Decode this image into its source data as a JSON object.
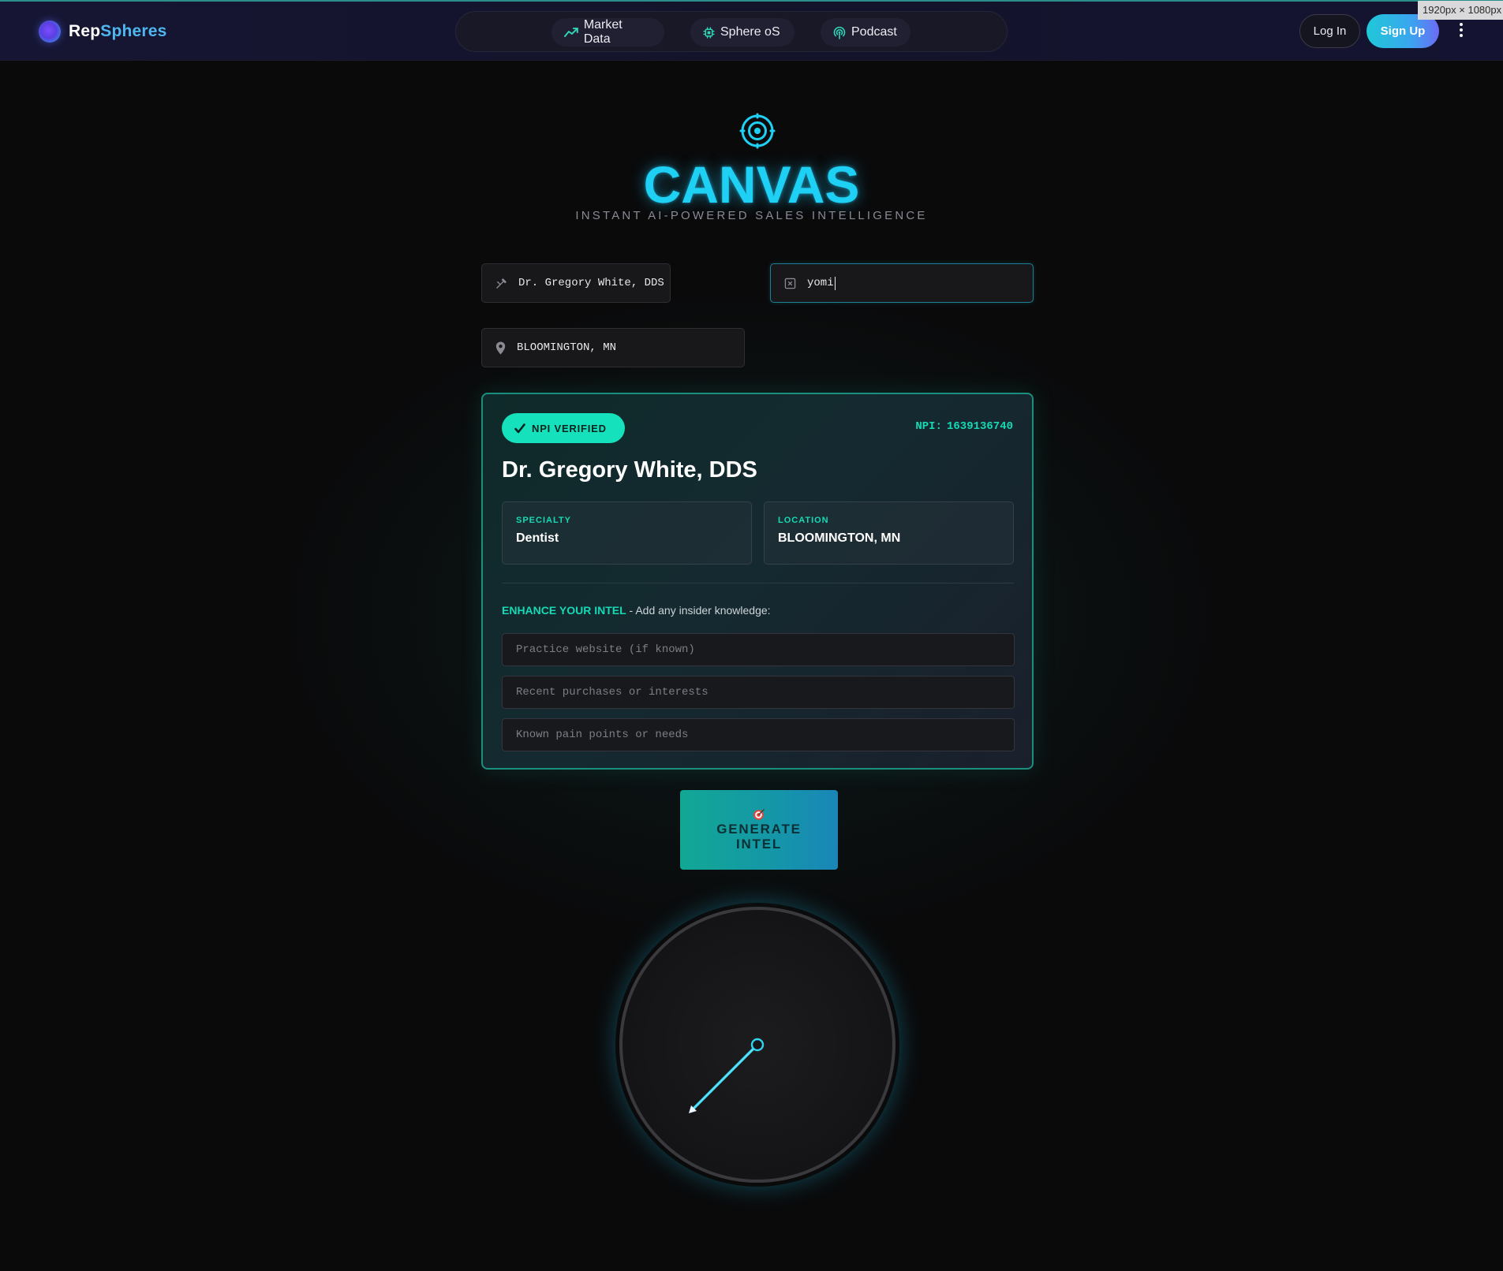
{
  "header": {
    "logo_part1": "Rep",
    "logo_part2": "Spheres",
    "nav": [
      {
        "label": "Market Data",
        "icon": "trend-chart-icon"
      },
      {
        "label": "Sphere oS",
        "icon": "chip-icon"
      },
      {
        "label": "Podcast",
        "icon": "broadcast-icon"
      }
    ],
    "login_label": "Log In",
    "signup_label": "Sign Up",
    "viewport_badge": "1920px × 1080px"
  },
  "hero": {
    "icon": "target-icon",
    "title": "CANVAS",
    "subtitle": "INSTANT AI-POWERED SALES INTELLIGENCE"
  },
  "search": {
    "doctor_value": "Dr. Gregory White, DDS",
    "query_value": "yomi",
    "location_value": "BLOOMINGTON, MN"
  },
  "result_card": {
    "badge": "NPI VERIFIED",
    "npi_label": "NPI:",
    "npi_value": "1639136740",
    "name": "Dr. Gregory White, DDS",
    "specialty_label": "SPECIALTY",
    "specialty_value": "Dentist",
    "location_label": "LOCATION",
    "location_value": "BLOOMINGTON, MN",
    "enhance_highlight": "ENHANCE YOUR INTEL",
    "enhance_text": " - Add any insider knowledge:",
    "inputs": [
      {
        "placeholder": "Practice website (if known)",
        "value": ""
      },
      {
        "placeholder": "Recent purchases or interests",
        "value": ""
      },
      {
        "placeholder": "Known pain points or needs",
        "value": ""
      }
    ]
  },
  "generate": {
    "label": "GENERATE INTEL",
    "icon": "bullseye-icon"
  },
  "gauge": {
    "icon": "gauge-dial-icon",
    "accent": "#1fd0f5"
  },
  "colors": {
    "accent_cyan": "#1fd0f5",
    "accent_teal": "#16d9b6",
    "background": "#0a0a0b"
  }
}
